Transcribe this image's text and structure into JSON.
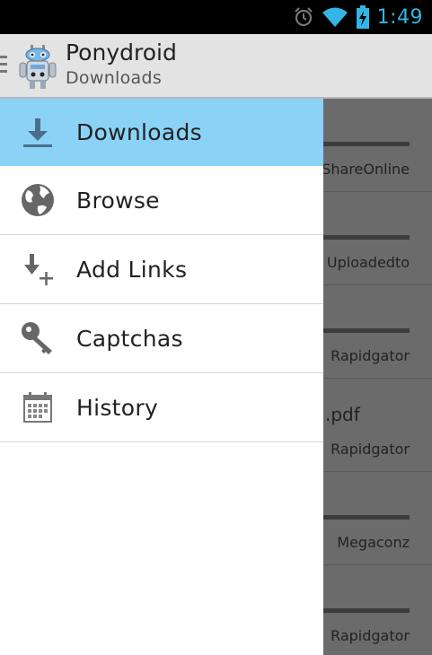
{
  "status_bar": {
    "time": "1:49",
    "icons": [
      "alarm-icon",
      "wifi-icon",
      "battery-charging-icon"
    ],
    "accent_color": "#33b5e5"
  },
  "action_bar": {
    "title": "Ponydroid",
    "subtitle": "Downloads",
    "icons": [
      "drawer-indicator-icon",
      "robot-logo-icon"
    ]
  },
  "drawer": {
    "items": [
      {
        "label": "Downloads",
        "icon": "download-icon",
        "active": true
      },
      {
        "label": "Browse",
        "icon": "globe-icon",
        "active": false
      },
      {
        "label": "Add Links",
        "icon": "add-links-icon",
        "active": false
      },
      {
        "label": "Captchas",
        "icon": "key-icon",
        "active": false
      },
      {
        "label": "History",
        "icon": "calendar-icon",
        "active": false
      }
    ],
    "active_color": "#8ad3f7"
  },
  "background_list": {
    "rows": [
      {
        "host": "ShareOnline",
        "filename": ""
      },
      {
        "host": "Uploadedto",
        "filename": ""
      },
      {
        "host": "Rapidgator",
        "filename": ""
      },
      {
        "host": "Rapidgator",
        "filename": ".pdf"
      },
      {
        "host": "Megaconz",
        "filename": ""
      },
      {
        "host": "Rapidgator",
        "filename": ""
      }
    ]
  }
}
